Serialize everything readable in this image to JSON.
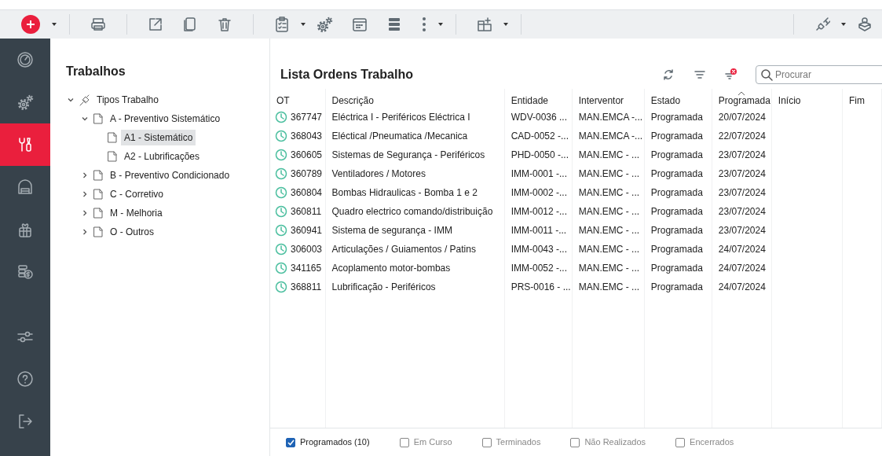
{
  "sidebar": {
    "items": [
      {
        "kind": "gauge",
        "selected": false
      },
      {
        "kind": "gears",
        "selected": false
      },
      {
        "kind": "tools",
        "selected": true
      },
      {
        "kind": "garage",
        "selected": false
      },
      {
        "kind": "gift",
        "selected": false
      },
      {
        "kind": "coins",
        "selected": false
      },
      {
        "kind": "sliders",
        "selected": false
      },
      {
        "kind": "help",
        "selected": false
      },
      {
        "kind": "exit",
        "selected": false
      }
    ]
  },
  "tree": {
    "title": "Trabalhos",
    "items": [
      {
        "label": "Tipos Trabalho",
        "kind": "root",
        "expanded": true,
        "selected": false,
        "children": [
          {
            "label": "A - Preventivo Sistemático",
            "kind": "doc",
            "expanded": true,
            "selected": false,
            "children": [
              {
                "label": "A1 - Sistemático",
                "kind": "doc",
                "selected": true
              },
              {
                "label": "A2 - Lubrificações",
                "kind": "doc",
                "selected": false
              }
            ]
          },
          {
            "label": "B - Preventivo Condicionado",
            "kind": "doc",
            "expanded": false,
            "selected": false
          },
          {
            "label": "C - Corretivo",
            "kind": "doc",
            "expanded": false,
            "selected": false
          },
          {
            "label": "M - Melhoria",
            "kind": "doc",
            "expanded": false,
            "selected": false
          },
          {
            "label": "O - Outros",
            "kind": "doc",
            "expanded": false,
            "selected": false
          }
        ]
      }
    ]
  },
  "list": {
    "title": "Lista Ordens Trabalho",
    "search": {
      "placeholder": "Procurar"
    },
    "table": {
      "columns": [
        {
          "label": "OT",
          "sorted": false
        },
        {
          "label": "Descrição",
          "sorted": false
        },
        {
          "label": "Entidade",
          "sorted": false
        },
        {
          "label": "Interventor",
          "sorted": false
        },
        {
          "label": "Estado",
          "sorted": false
        },
        {
          "label": "Programada",
          "sorted": true
        },
        {
          "label": "Início",
          "sorted": false
        },
        {
          "label": "Fim",
          "sorted": false
        }
      ],
      "rows": [
        [
          "367747",
          "Eléctrica I - Periféricos Eléctrica I",
          "WDV-0036 ...",
          "MAN.EMCA -...",
          "Programada",
          "20/07/2024"
        ],
        [
          "368043",
          "Eléctical /Pneumatica /Mecanica",
          "CAD-0052 -...",
          "MAN.EMCA -...",
          "Programada",
          "22/07/2024"
        ],
        [
          "360605",
          "Sistemas de Segurança - Periféricos",
          "PHD-0050 -...",
          "MAN.EMC - ...",
          "Programada",
          "23/07/2024"
        ],
        [
          "360789",
          "Ventiladores / Motores",
          "IMM-0001 -...",
          "MAN.EMC - ...",
          "Programada",
          "23/07/2024"
        ],
        [
          "360804",
          "Bombas Hidraulicas - Bomba 1 e 2",
          "IMM-0002 -...",
          "MAN.EMC - ...",
          "Programada",
          "23/07/2024"
        ],
        [
          "360811",
          "Quadro electrico comando/distribuição",
          "IMM-0012 -...",
          "MAN.EMC - ...",
          "Programada",
          "23/07/2024"
        ],
        [
          "360941",
          "Sistema de segurança - IMM",
          "IMM-0011 -...",
          "MAN.EMC - ...",
          "Programada",
          "23/07/2024"
        ],
        [
          "306003",
          "Articulações / Guiamentos / Patins",
          "IMM-0043 -...",
          "MAN.EMC - ...",
          "Programada",
          "24/07/2024"
        ],
        [
          "341165",
          "Acoplamento motor-bombas",
          "IMM-0052 -...",
          "MAN.EMC - ...",
          "Programada",
          "24/07/2024"
        ],
        [
          "368811",
          "Lubrificação  - Periféricos",
          "PRS-0016 - ...",
          "MAN.EMC - ...",
          "Programada",
          "24/07/2024"
        ]
      ]
    },
    "filters": [
      {
        "label": "Programados (10)",
        "checked": true
      },
      {
        "label": "Em Curso",
        "checked": false
      },
      {
        "label": "Terminados",
        "checked": false
      },
      {
        "label": "Não Realizados",
        "checked": false
      },
      {
        "label": "Encerrados",
        "checked": false
      }
    ]
  }
}
